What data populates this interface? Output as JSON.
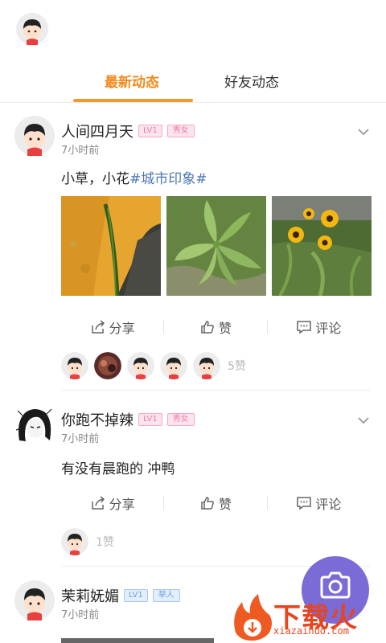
{
  "tabs": [
    {
      "label": "最新动态",
      "active": true
    },
    {
      "label": "好友动态",
      "active": false
    }
  ],
  "colors": {
    "accent": "#f39a2a",
    "topic": "#4e77b4",
    "badge_pink": "#f27aa6",
    "badge_blue": "#6d9ee0",
    "camera": "#7b6bd6",
    "watermark": "#e8441f"
  },
  "posts": [
    {
      "name": "人间四月天",
      "level": "LV1",
      "tag": "秀女",
      "time": "7小时前",
      "text": "小草，小花",
      "topic": "#城市印象#",
      "actions": {
        "share": "分享",
        "like": "赞",
        "comment": "评论"
      },
      "like_count": "5赞"
    },
    {
      "name": "你跑不掉辣",
      "level": "LV1",
      "tag": "秀女",
      "time": "7小时前",
      "text": "有没有晨跑的 冲鸭",
      "actions": {
        "share": "分享",
        "like": "赞",
        "comment": "评论"
      },
      "like_count": "1赞"
    },
    {
      "name": "茉莉妩媚",
      "level": "LV1",
      "tag": "举人",
      "time": "7小时前"
    }
  ],
  "watermark": {
    "text": "下载火",
    "url": "xiazaihuo.com"
  },
  "icons": [
    "avatar-icon",
    "chevron-down-icon",
    "share-icon",
    "thumb-up-icon",
    "comment-icon",
    "camera-icon",
    "watermark-logo-icon"
  ]
}
